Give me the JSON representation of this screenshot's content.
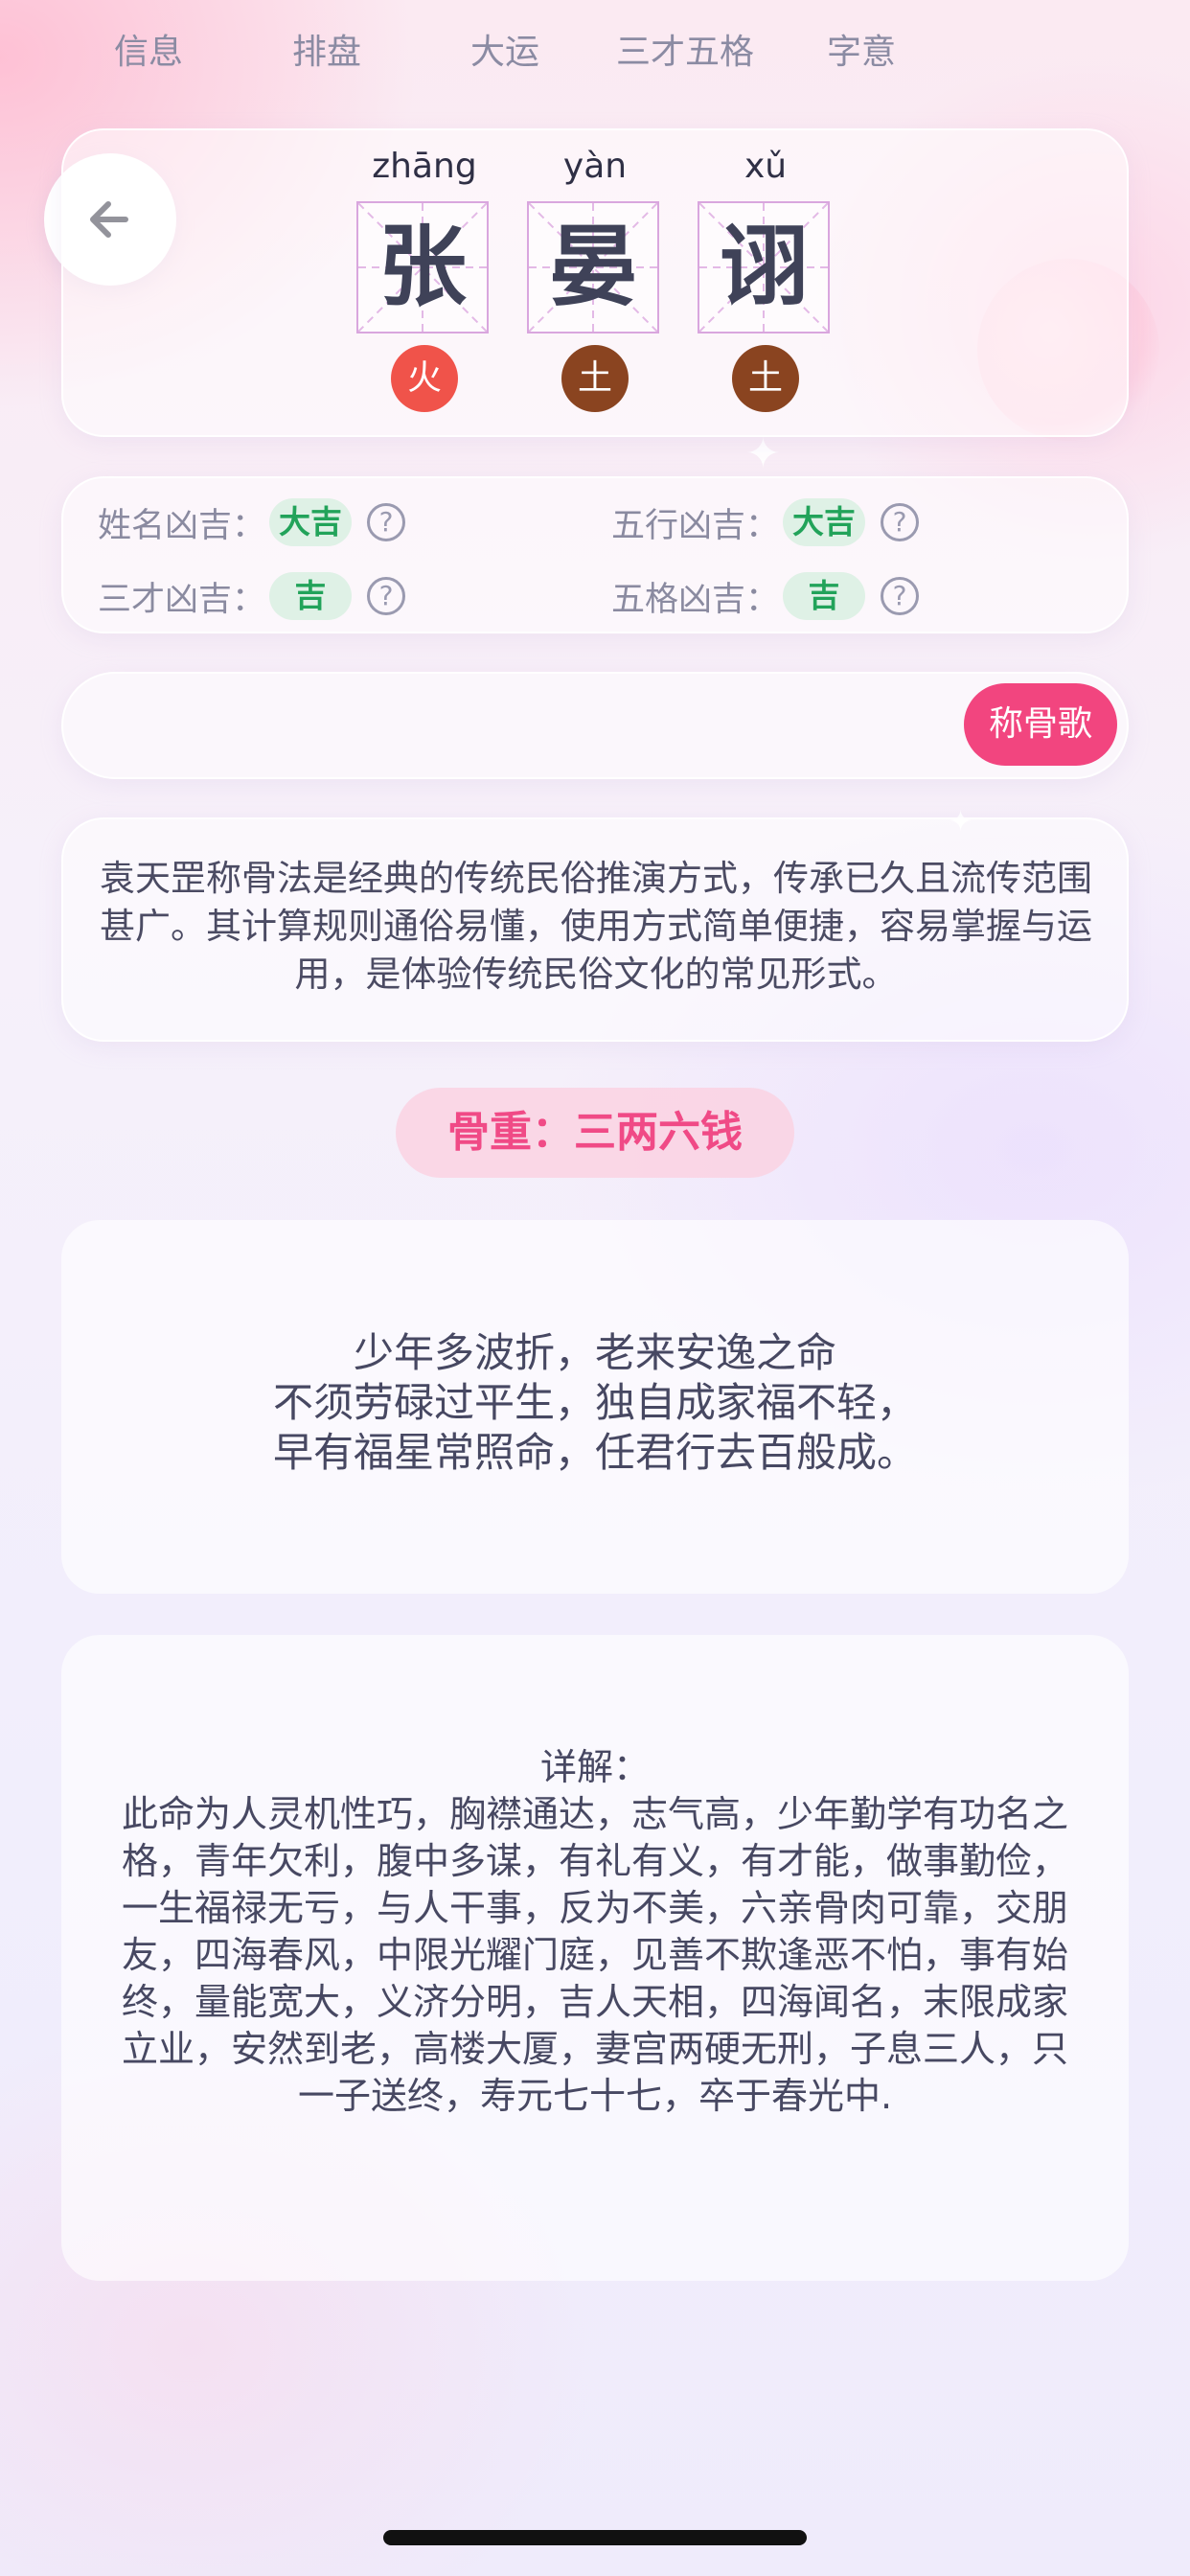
{
  "name": {
    "chars": [
      {
        "pinyin": "zhāng",
        "char": "张",
        "element": "火",
        "element_color": "#f0534a"
      },
      {
        "pinyin": "yàn",
        "char": "晏",
        "element": "土",
        "element_color": "#8a4420"
      },
      {
        "pinyin": "xǔ",
        "char": "诩",
        "element": "土",
        "element_color": "#8a4420"
      }
    ]
  },
  "fortune": {
    "name_label": "姓名凶吉：",
    "name_value": "大吉",
    "wuxing_label": "五行凶吉：",
    "wuxing_value": "大吉",
    "sancai_label": "三才凶吉：",
    "sancai_value": "吉",
    "wuge_label": "五格凶吉：",
    "wuge_value": "吉",
    "help_symbol": "?"
  },
  "tabs": [
    {
      "label": "信息",
      "active": false
    },
    {
      "label": "排盘",
      "active": false
    },
    {
      "label": "大运",
      "active": false
    },
    {
      "label": "三才五格",
      "active": false
    },
    {
      "label": "字意",
      "active": false
    },
    {
      "label": "称骨歌",
      "active": true
    }
  ],
  "intro": "袁天罡称骨法是经典的传统民俗推演方式，传承已久且流传范围甚广。其计算规则通俗易懂，使用方式简单便捷，容易掌握与运用，是体验传统民俗文化的常见形式。",
  "bone_weight": "骨重：三两六钱",
  "poem": {
    "line1": "少年多波折，老来安逸之命",
    "line2": "不须劳碌过平生，独自成家福不轻，",
    "line3": "早有福星常照命，任君行去百般成。"
  },
  "detail": {
    "heading": "详解：",
    "body": "此命为人灵机性巧，胸襟通达，志气高，少年勤学有功名之格，青年欠利，腹中多谋，有礼有义，有才能，做事勤俭，一生福禄无亏，与人干事，反为不美，六亲骨肉可靠，交朋友，四海春风，中限光耀门庭，见善不欺逢恶不怕，事有始终，量能宽大，义济分明，吉人天相，四海闻名，末限成家立业，安然到老，高楼大厦，妻宫两硬无刑，子息三人，只一子送终，寿元七十七，卒于春光中."
  },
  "colors": {
    "accent_pink": "#f2457f",
    "good_green": "#22a35a"
  },
  "icons": {
    "back": "arrow-left-icon",
    "help": "question-circle-icon"
  }
}
